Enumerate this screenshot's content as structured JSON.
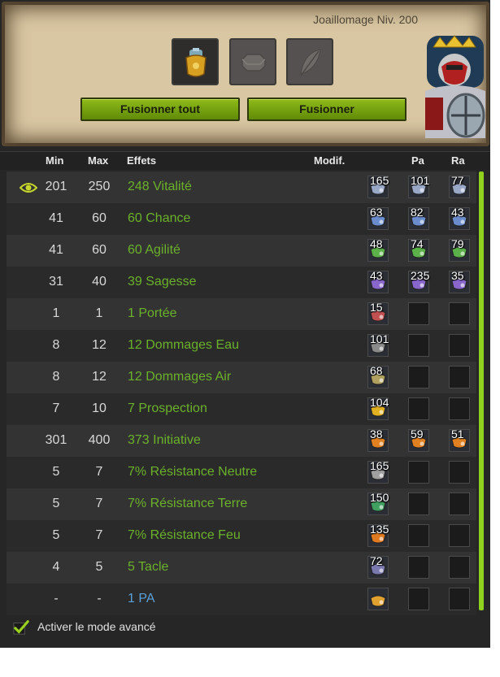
{
  "header": {
    "title": "Joaillomage Niv. 200",
    "slots": [
      {
        "name": "item-slot",
        "icon": "golden-armor-icon",
        "active": true
      },
      {
        "name": "rune-slot",
        "icon": "hexagon-stone-icon",
        "active": false
      },
      {
        "name": "potion-slot",
        "icon": "feather-icon",
        "active": false
      }
    ],
    "buttons": {
      "merge_all_label": "Fusionner tout",
      "merge_label": "Fusionner"
    },
    "avatar_icon": "character-portrait-icon"
  },
  "table": {
    "headers": {
      "min": "Min",
      "max": "Max",
      "effects": "Effets",
      "modif": "Modif.",
      "pa": "Pa",
      "ra": "Ra"
    },
    "rows": [
      {
        "min": "201",
        "max": "250",
        "effect": "248 Vitalité",
        "rune_color": "#9aa8c8",
        "runes": [
          "165",
          "101",
          "77"
        ],
        "eye": true
      },
      {
        "min": "41",
        "max": "60",
        "effect": "60 Chance",
        "rune_color": "#6a8ccc",
        "runes": [
          "63",
          "82",
          "43"
        ]
      },
      {
        "min": "41",
        "max": "60",
        "effect": "60 Agilité",
        "rune_color": "#5bb04a",
        "runes": [
          "48",
          "74",
          "79"
        ]
      },
      {
        "min": "31",
        "max": "40",
        "effect": "39 Sagesse",
        "rune_color": "#8866cc",
        "runes": [
          "43",
          "235",
          "35"
        ]
      },
      {
        "min": "1",
        "max": "1",
        "effect": "1 Portée",
        "rune_color": "#c05050",
        "runes": [
          "15",
          "",
          ""
        ]
      },
      {
        "min": "8",
        "max": "12",
        "effect": "12 Dommages Eau",
        "rune_color": "#8a8a8a",
        "runes": [
          "101",
          "",
          ""
        ]
      },
      {
        "min": "8",
        "max": "12",
        "effect": "12 Dommages Air",
        "rune_color": "#b0a060",
        "runes": [
          "68",
          "",
          ""
        ]
      },
      {
        "min": "7",
        "max": "10",
        "effect": "7 Prospection",
        "rune_color": "#e0b020",
        "runes": [
          "104",
          "",
          ""
        ]
      },
      {
        "min": "301",
        "max": "400",
        "effect": "373 Initiative",
        "rune_color": "#e08020",
        "runes": [
          "38",
          "59",
          "51"
        ]
      },
      {
        "min": "5",
        "max": "7",
        "effect": "7% Résistance Neutre",
        "rune_color": "#a0a0a0",
        "runes": [
          "165",
          "",
          ""
        ]
      },
      {
        "min": "5",
        "max": "7",
        "effect": "7% Résistance Terre",
        "rune_color": "#40a060",
        "runes": [
          "150",
          "",
          ""
        ]
      },
      {
        "min": "5",
        "max": "7",
        "effect": "7% Résistance Feu",
        "rune_color": "#e07a20",
        "runes": [
          "135",
          "",
          ""
        ]
      },
      {
        "min": "4",
        "max": "5",
        "effect": "5 Tacle",
        "rune_color": "#7a7ab0",
        "runes": [
          "72",
          "",
          ""
        ]
      },
      {
        "min": "-",
        "max": "-",
        "effect": "1 PA",
        "rune_color": "#e0a030",
        "runes": [
          "",
          "",
          ""
        ],
        "blue": true
      }
    ]
  },
  "footer": {
    "advanced_mode_label": "Activer le mode avancé",
    "advanced_mode_checked": true
  },
  "colors": {
    "accent_green": "#8fd11c",
    "effect_green": "#6bb22a",
    "effect_blue": "#5aa0d8"
  }
}
